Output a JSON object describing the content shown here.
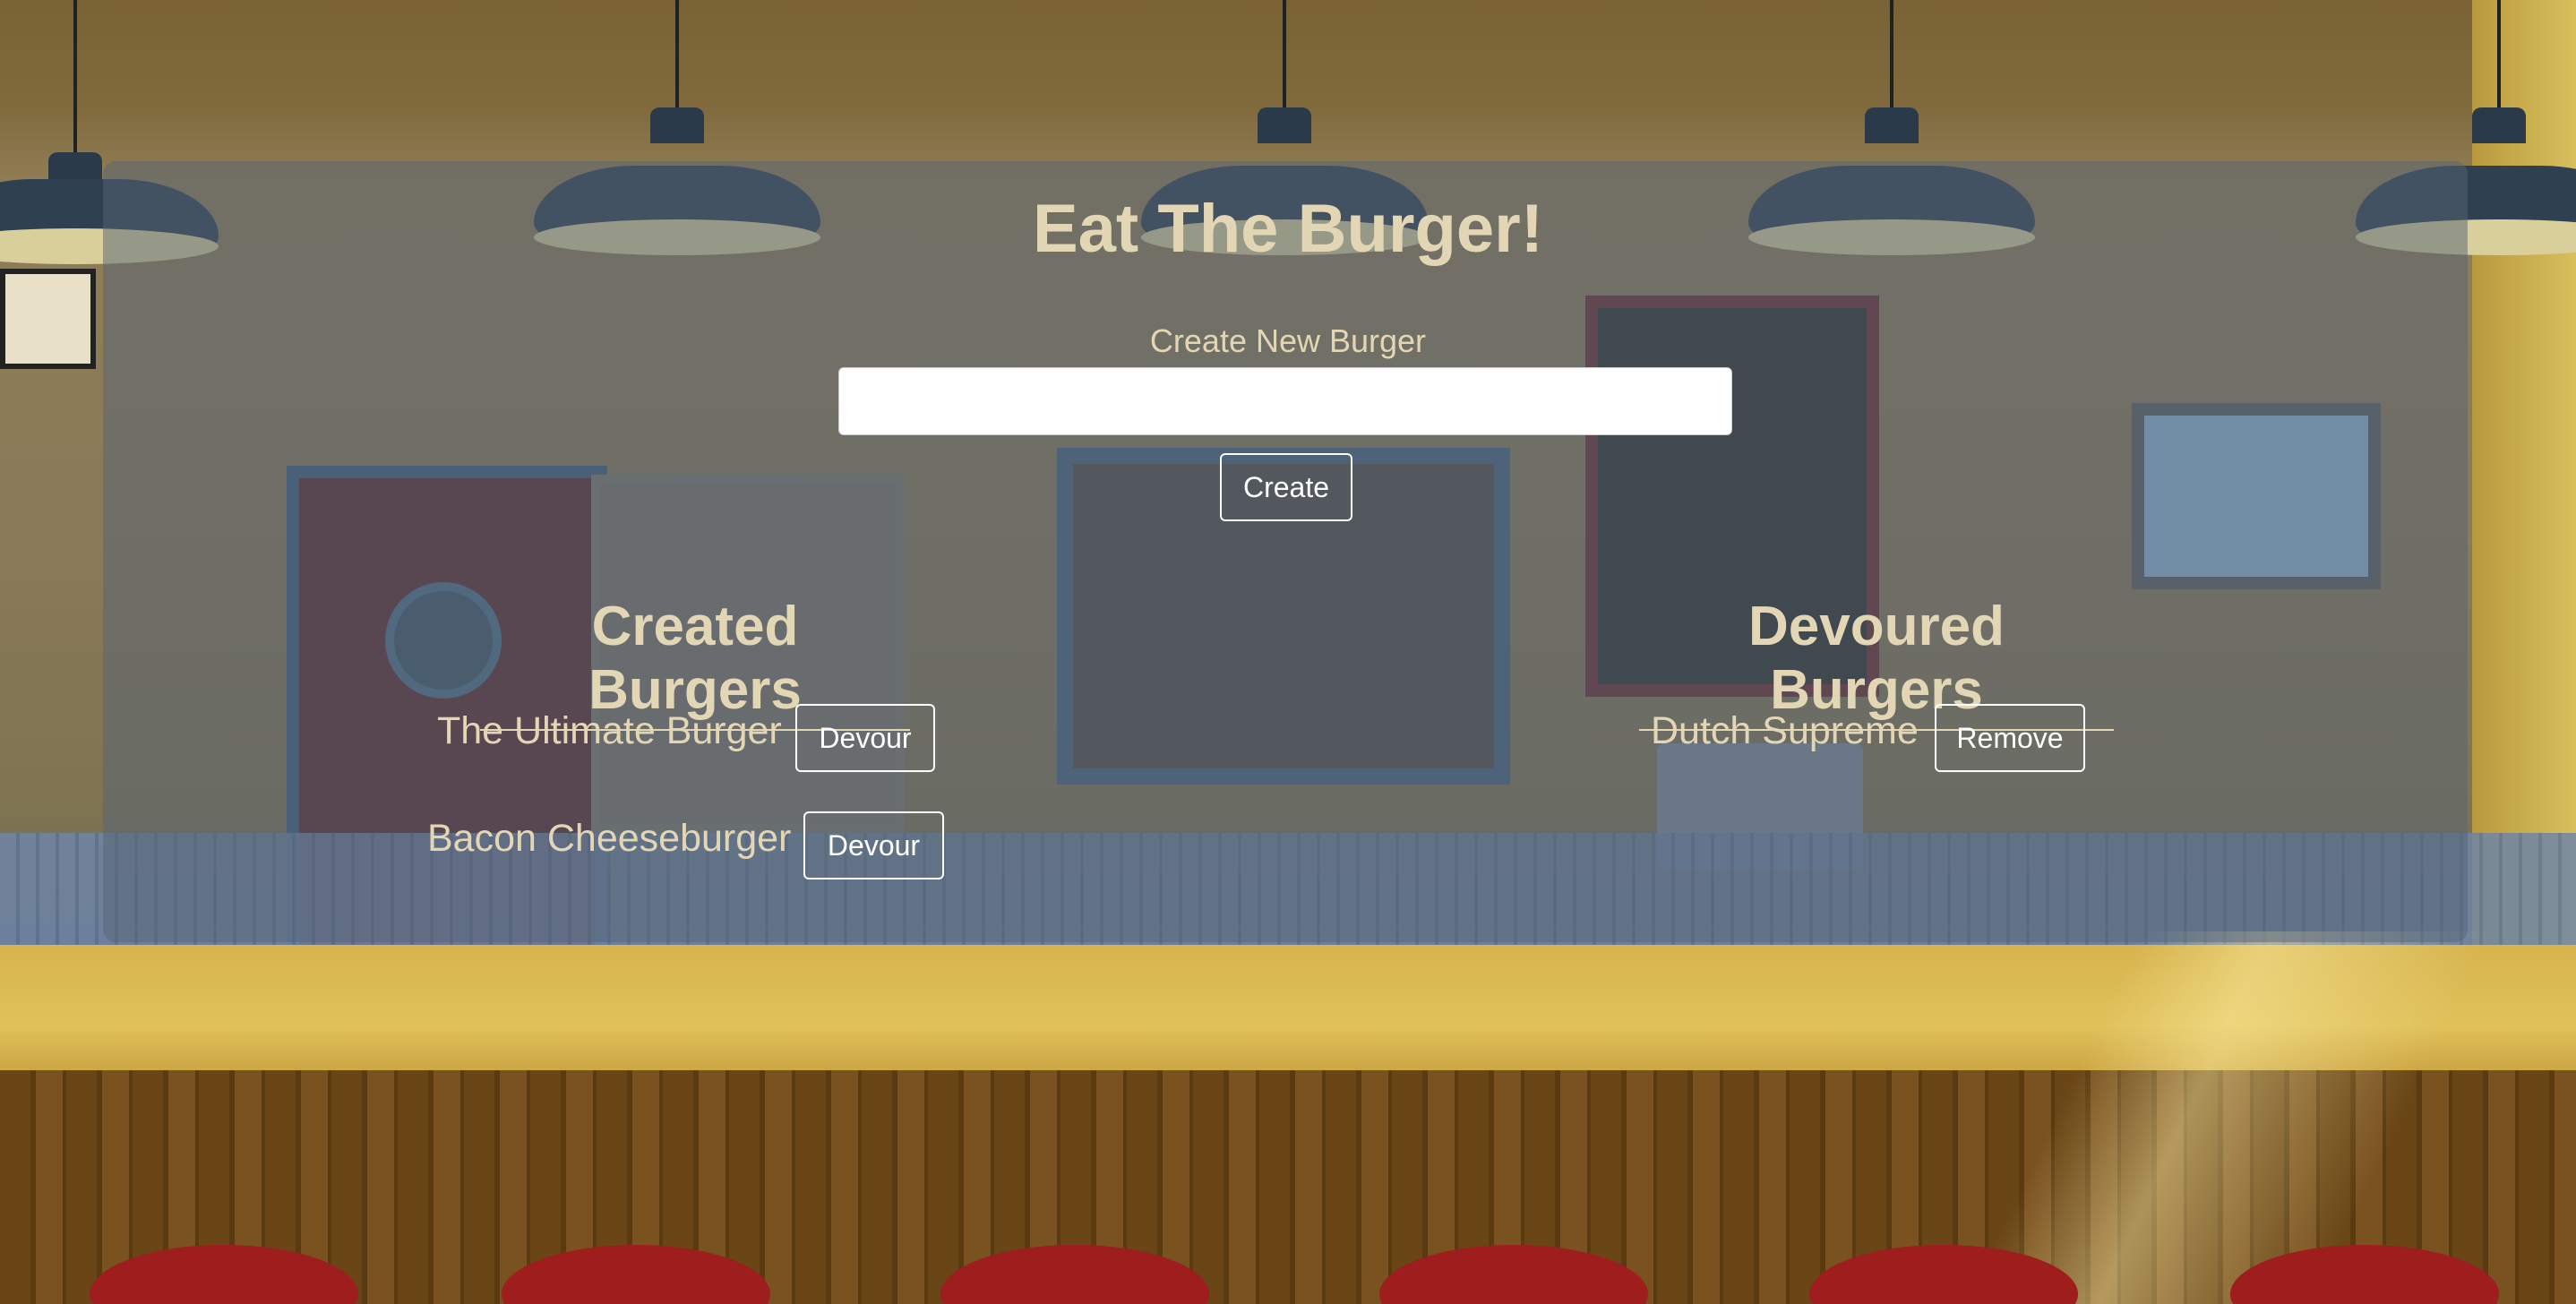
{
  "page": {
    "title": "Eat The Burger!",
    "create_label": "Create New Burger",
    "create_input": {
      "value": "",
      "placeholder": ""
    },
    "create_button": "Create"
  },
  "created": {
    "heading": "Created Burgers",
    "items": [
      {
        "name": "The Ultimate Burger",
        "action": "Devour"
      },
      {
        "name": "Bacon Cheeseburger",
        "action": "Devour"
      }
    ]
  },
  "devoured": {
    "heading": "Devoured Burgers",
    "items": [
      {
        "name": "Dutch Supreme",
        "action": "Remove"
      }
    ]
  },
  "colors": {
    "text": "#e3d6b4",
    "panel": "#566476",
    "button_border": "#ffffff"
  }
}
